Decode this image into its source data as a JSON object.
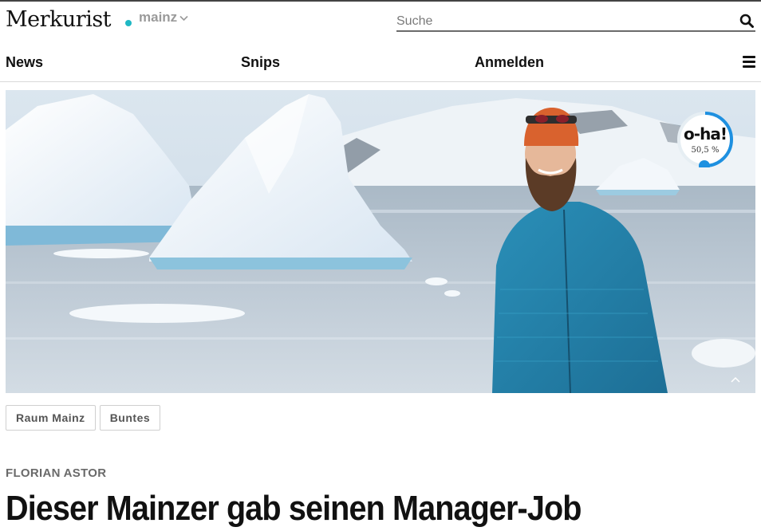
{
  "header": {
    "logo_text": "Merkurist",
    "region": "mainz",
    "search_placeholder": "Suche",
    "accent_color": "#1fb8c4"
  },
  "nav": {
    "items": [
      {
        "label": "News"
      },
      {
        "label": "Snips"
      },
      {
        "label": "Anmelden"
      }
    ],
    "menu_icon": "hamburger-icon"
  },
  "hero": {
    "badge_title": "o-ha!",
    "badge_percent": "50,5 %",
    "badge_progress": 0.505
  },
  "tags": [
    {
      "label": "Raum Mainz"
    },
    {
      "label": "Buntes"
    }
  ],
  "article": {
    "author": "FLORIAN ASTOR",
    "headline": "Dieser Mainzer gab seinen Manager-Job"
  }
}
